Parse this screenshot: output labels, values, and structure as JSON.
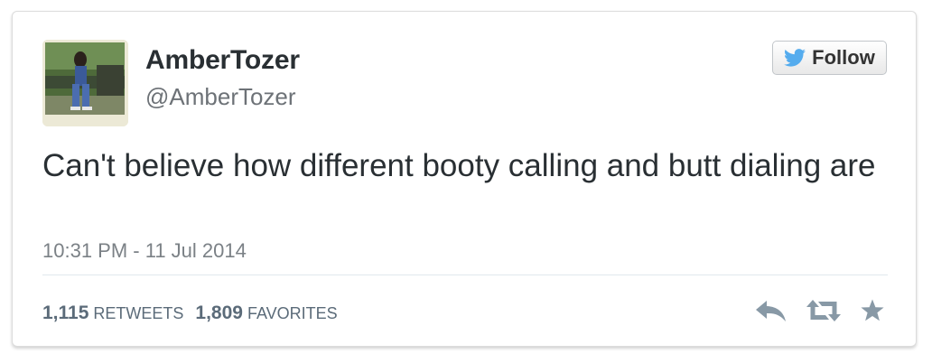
{
  "user": {
    "display_name": "AmberTozer",
    "handle": "@AmberTozer"
  },
  "follow_button": {
    "label": "Follow",
    "icon": "twitter-bird-icon"
  },
  "tweet": {
    "text": "Can't believe how different booty calling and butt dialing are",
    "timestamp": "10:31 PM - 11 Jul 2014"
  },
  "stats": {
    "retweets_count": "1,115",
    "retweets_label": "RETWEETS",
    "favorites_count": "1,809",
    "favorites_label": "FAVORITES"
  },
  "actions": [
    {
      "icon": "reply-icon"
    },
    {
      "icon": "retweet-icon"
    },
    {
      "icon": "favorite-star-icon"
    }
  ],
  "colors": {
    "twitter_blue": "#55acee",
    "text_dark": "#292f33",
    "text_muted": "#6d7277",
    "stat_text": "#5b6b79",
    "action_gray": "#8899a6"
  }
}
